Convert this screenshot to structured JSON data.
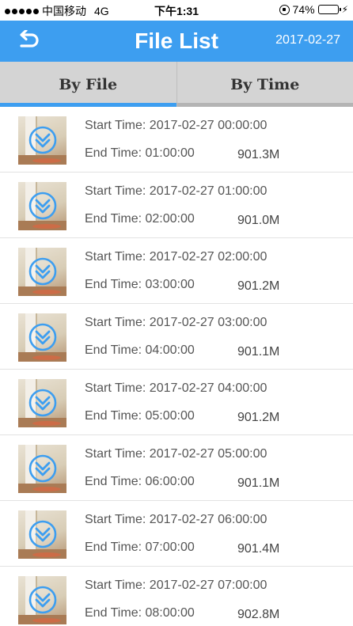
{
  "status_bar": {
    "carrier": "中国移动",
    "network": "4G",
    "time": "下午1:31",
    "battery": "74%",
    "battery_level": 0.74
  },
  "header": {
    "title": "File List",
    "date": "2017-02-27",
    "back_icon": "back-arrow-icon"
  },
  "tabs": [
    {
      "label": "By File",
      "active": true
    },
    {
      "label": "By Time",
      "active": false
    }
  ],
  "files": [
    {
      "start": "Start Time: 2017-02-27 00:00:00",
      "end": "End Time: 01:00:00",
      "size": "901.3M"
    },
    {
      "start": "Start Time: 2017-02-27 01:00:00",
      "end": "End Time: 02:00:00",
      "size": "901.0M"
    },
    {
      "start": "Start Time: 2017-02-27 02:00:00",
      "end": "End Time: 03:00:00",
      "size": "901.2M"
    },
    {
      "start": "Start Time: 2017-02-27 03:00:00",
      "end": "End Time: 04:00:00",
      "size": "901.1M"
    },
    {
      "start": "Start Time: 2017-02-27 04:00:00",
      "end": "End Time: 05:00:00",
      "size": "901.2M"
    },
    {
      "start": "Start Time: 2017-02-27 05:00:00",
      "end": "End Time: 06:00:00",
      "size": "901.1M"
    },
    {
      "start": "Start Time: 2017-02-27 06:00:00",
      "end": "End Time: 07:00:00",
      "size": "901.4M"
    },
    {
      "start": "Start Time: 2017-02-27 07:00:00",
      "end": "End Time: 08:00:00",
      "size": "902.8M"
    }
  ],
  "colors": {
    "accent": "#3d9ef0",
    "tab_bar": "#d4d4d4",
    "download_icon": "#3d9ef0"
  }
}
